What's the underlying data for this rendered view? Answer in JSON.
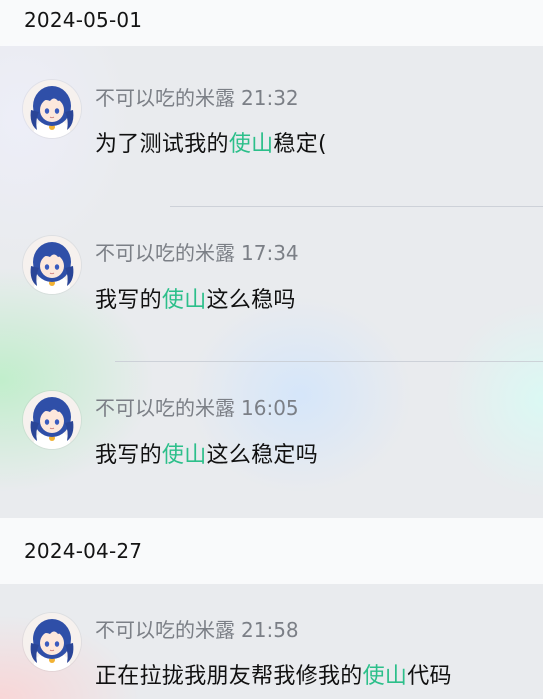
{
  "groups": [
    {
      "date": "2024-05-01",
      "posts": [
        {
          "author": "不可以吃的米露",
          "time": "21:32",
          "before": "为了测试我的",
          "mention": "使山",
          "after": "稳定("
        },
        {
          "author": "不可以吃的米露",
          "time": "17:34",
          "before": "我写的",
          "mention": "使山",
          "after": "这么稳吗"
        },
        {
          "author": "不可以吃的米露",
          "time": "16:05",
          "before": "我写的",
          "mention": "使山",
          "after": "这么稳定吗"
        }
      ]
    },
    {
      "date": "2024-04-27",
      "posts": [
        {
          "author": "不可以吃的米露",
          "time": "21:58",
          "before": "正在拉拢我朋友帮我修我的",
          "mention": "使山",
          "after": "代码"
        }
      ]
    }
  ],
  "colors": {
    "mention": "#2cbf8a",
    "meta_text": "#7b7f86",
    "header_bg": "#fafbfc",
    "page_bg": "#e9ebee"
  },
  "icons": {
    "avatar": "anime-girl-blue-hair-avatar"
  }
}
